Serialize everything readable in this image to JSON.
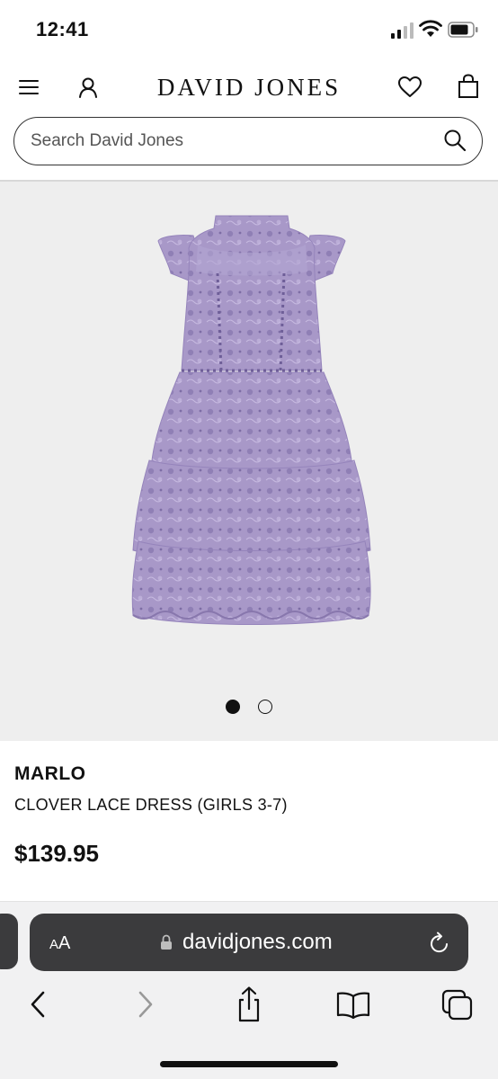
{
  "status_bar": {
    "time": "12:41"
  },
  "header": {
    "brand": "DAVID JONES",
    "menu_icon": "hamburger-menu-icon",
    "account_icon": "user-icon",
    "wishlist_icon": "heart-icon",
    "bag_icon": "shopping-bag-icon"
  },
  "search": {
    "placeholder": "Search David Jones",
    "value": ""
  },
  "gallery": {
    "image_count": 2,
    "active_index": 0,
    "image": "lavender lace tiered dress"
  },
  "product": {
    "brand": "MARLO",
    "name": "CLOVER LACE DRESS (GIRLS 3-7)",
    "price": "$139.95"
  },
  "browser": {
    "text_size_small": "A",
    "text_size_large": "A",
    "url": "davidjones.com",
    "toolbar_icons": [
      "back-icon",
      "forward-icon",
      "share-icon",
      "bookmarks-icon",
      "tabs-icon"
    ]
  },
  "colors": {
    "dress": "#a696c6",
    "gallery_bg": "#eeeeee",
    "url_bar": "#3b3b3d"
  }
}
